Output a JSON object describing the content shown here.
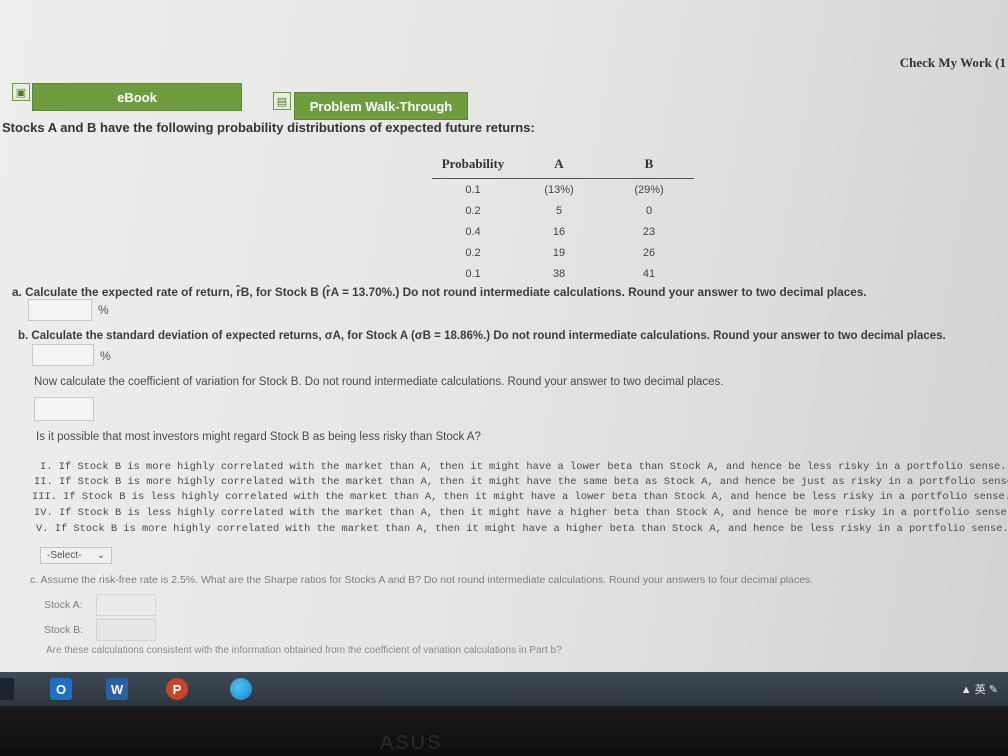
{
  "header": {
    "check_my_work": "Check My Work (1"
  },
  "tabs": {
    "ebook": "eBook",
    "walkthrough": "Problem Walk-Through"
  },
  "intro": "Stocks A and B have the following probability distributions of expected future returns:",
  "table": {
    "headers": [
      "Probability",
      "A",
      "B"
    ],
    "rows": [
      [
        "0.1",
        "(13%)",
        "(29%)"
      ],
      [
        "0.2",
        "5",
        "0"
      ],
      [
        "0.4",
        "16",
        "23"
      ],
      [
        "0.2",
        "19",
        "26"
      ],
      [
        "0.1",
        "38",
        "41"
      ]
    ]
  },
  "part_a": {
    "question": "a. Calculate the expected rate of return, r̂B, for Stock B (r̂A = 13.70%.) Do not round intermediate calculations. Round your answer to two decimal places.",
    "unit": "%"
  },
  "part_b": {
    "question": "b. Calculate the standard deviation of expected returns, σA, for Stock A (σB = 18.86%.) Do not round intermediate calculations. Round your answer to two decimal places.",
    "unit": "%",
    "cv_question": "Now calculate the coefficient of variation for Stock B. Do not round intermediate calculations. Round your answer to two decimal places.",
    "risk_question": "Is it possible that most investors might regard Stock B as being less risky than Stock A?",
    "options": [
      "I. If Stock B is more highly correlated with the market than A, then it might have a lower beta than Stock A, and hence be less risky in a portfolio sense.",
      "II. If Stock B is more highly correlated with the market than A, then it might have the same beta as Stock A, and hence be just as risky in a portfolio sense.",
      "III. If Stock B is less highly correlated with the market than A, then it might have a lower beta than Stock A, and hence be less risky in a portfolio sense.",
      "IV. If Stock B is less highly correlated with the market than A, then it might have a higher beta than Stock A, and hence be more risky in a portfolio sense.",
      "V. If Stock B is more highly correlated with the market than A, then it might have a higher beta than Stock A, and hence be less risky in a portfolio sense."
    ],
    "select_label": "-Select-"
  },
  "part_c": {
    "question": "c. Assume the risk-free rate is 2.5%. What are the Sharpe ratios for Stocks A and B? Do not round intermediate calculations. Round your answers to four decimal places.",
    "stock_a_label": "Stock A:",
    "stock_b_label": "Stock B:",
    "consistency_question": "Are these calculations consistent with the information obtained from the coefficient of variation calculations in Part b?"
  },
  "taskbar": {
    "icons": [
      "O",
      "W",
      "P"
    ],
    "tray": "▲ 英 ✎"
  },
  "bezel": {
    "logo": "ASUS"
  },
  "colors": {
    "tab_green": "#6f9c3e",
    "taskbar": "#36414c"
  }
}
